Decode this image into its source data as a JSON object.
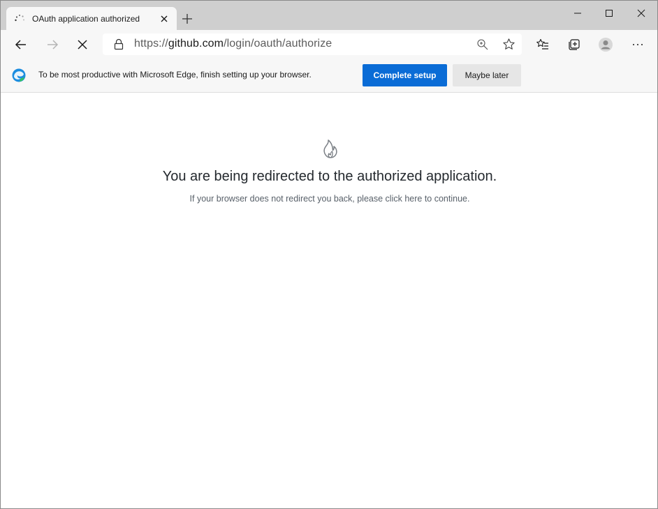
{
  "browser": {
    "tab": {
      "title": "OAuth application authorized"
    },
    "address_bar": {
      "url_scheme": "https://",
      "url_host": "github.com",
      "url_path": "/login/oauth/authorize"
    },
    "accent_color": "#0a6cd6"
  },
  "infobar": {
    "message": "To be most productive with Microsoft Edge, finish setting up your browser.",
    "complete_label": "Complete setup",
    "later_label": "Maybe later"
  },
  "page": {
    "heading": "You are being redirected to the authorized application.",
    "sub_before": "If your browser does not redirect you back, please ",
    "sub_link": "click here",
    "sub_after": " to continue."
  },
  "icons": [
    "loading-spinner-icon",
    "close-icon",
    "plus-icon",
    "minimize-icon",
    "maximize-icon",
    "window-close-icon",
    "back-arrow-icon",
    "forward-arrow-icon",
    "stop-icon",
    "lock-icon",
    "zoom-icon",
    "star-icon",
    "favorites-icon",
    "collections-icon",
    "profile-icon",
    "more-icon",
    "edge-logo-icon",
    "flame-icon"
  ]
}
